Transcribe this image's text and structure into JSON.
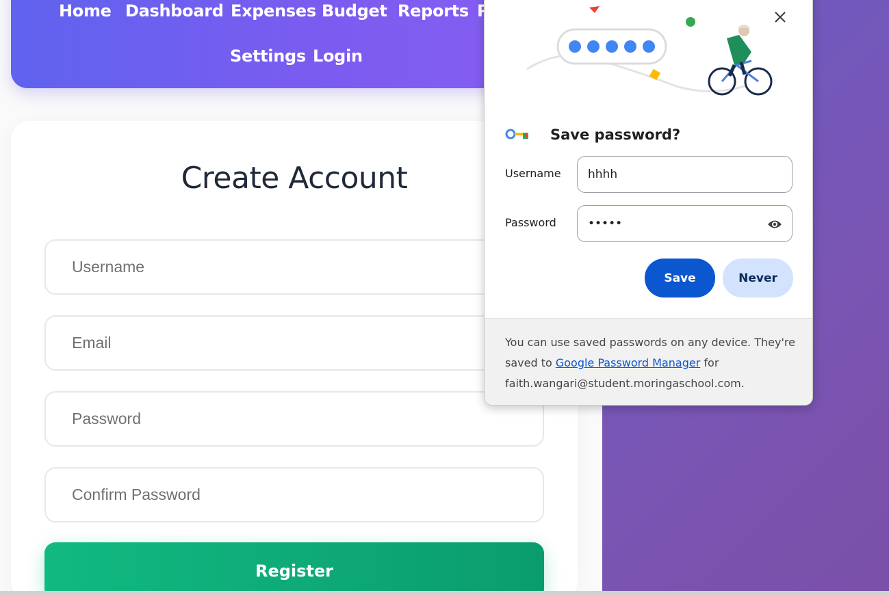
{
  "nav": {
    "links": [
      "Home",
      "Dashboard",
      "Expenses",
      "Budget",
      "Reports",
      "P",
      "Settings",
      "Login"
    ]
  },
  "form": {
    "title": "Create Account",
    "username_placeholder": "Username",
    "email_placeholder": "Email",
    "password_placeholder": "Password",
    "confirm_placeholder": "Confirm Password",
    "register_label": "Register"
  },
  "popup": {
    "title": "Save password?",
    "username_label": "Username",
    "username_value": "hhhh",
    "password_label": "Password",
    "password_value": "hhhhh",
    "save_label": "Save",
    "never_label": "Never",
    "footer_before": "You can use saved passwords on any device. They're saved to ",
    "footer_link": "Google Password Manager",
    "footer_after": " for faith.wangari@student.moringaschool.com."
  },
  "colors": {
    "nav_gradient_start": "#5f63ef",
    "nav_gradient_end": "#8a5ef2",
    "register_green": "#11b981",
    "save_blue": "#0b57d0",
    "never_bg": "#d3e3fd",
    "right_panel_purple": "#7257b9"
  },
  "icons": {
    "close": "close-icon",
    "key": "key-icon",
    "eye": "eye-icon"
  }
}
